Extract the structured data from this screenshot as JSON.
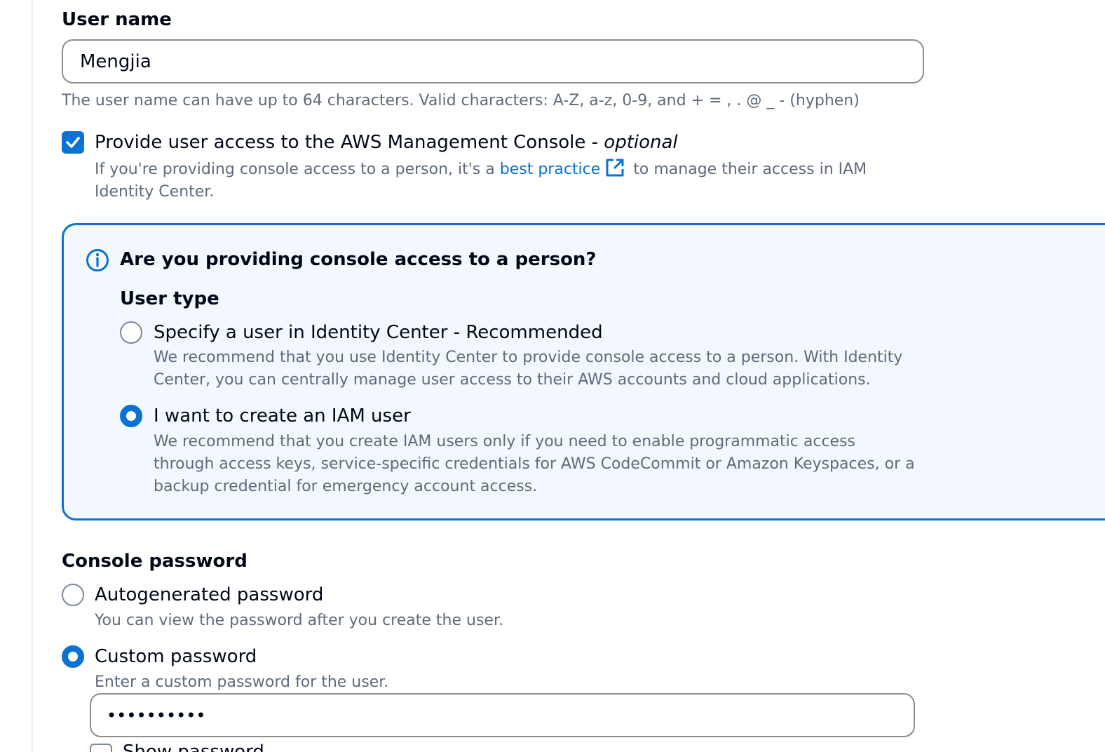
{
  "user_name": {
    "label": "User name",
    "value": "Mengjia",
    "hint": "The user name can have up to 64 characters. Valid characters: A-Z, a-z, 0-9, and + = , . @ _ - (hyphen)"
  },
  "console_access": {
    "checked": true,
    "label": "Provide user access to the AWS Management Console - ",
    "label_optional": "optional",
    "desc_before": "If you're providing console access to a person, it's a ",
    "desc_link": "best practice",
    "desc_after": " to manage their access in IAM Identity Center."
  },
  "info_panel": {
    "title": "Are you providing console access to a person?",
    "user_type_label": "User type",
    "options": [
      {
        "label": "Specify a user in Identity Center - Recommended",
        "desc": "We recommend that you use Identity Center to provide console access to a person. With Identity Center, you can centrally manage user access to their AWS accounts and cloud applications.",
        "selected": false
      },
      {
        "label": "I want to create an IAM user",
        "desc": "We recommend that you create IAM users only if you need to enable programmatic access through access keys, service-specific credentials for AWS CodeCommit or Amazon Keyspaces, or a backup credential for emergency account access.",
        "selected": true
      }
    ]
  },
  "console_password": {
    "label": "Console password",
    "options": [
      {
        "label": "Autogenerated password",
        "desc": "You can view the password after you create the user.",
        "selected": false
      },
      {
        "label": "Custom password",
        "desc": "Enter a custom password for the user.",
        "selected": true
      }
    ],
    "password_value": "••••••••••",
    "show_password_label": "Show password"
  },
  "colors": {
    "accent": "#0972d3",
    "panel_bg": "#f2f8fd",
    "text_secondary": "#5f6b7a",
    "border": "#8c8c94"
  },
  "icons": {
    "info": "info-circle-icon",
    "external_link": "external-link-icon",
    "checkmark": "checkmark-icon"
  }
}
